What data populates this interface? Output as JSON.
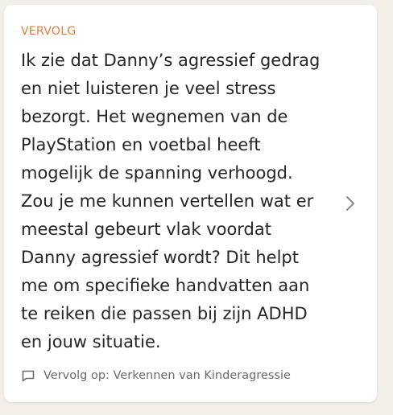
{
  "card": {
    "label": "VERVOLG",
    "body": "Ik zie dat Danny’s agressief gedrag en niet luisteren je veel stress bezorgt. Het wegnemen van de PlayStation en voetbal heeft mogelijk de spanning verhoogd. Zou je me kunnen vertellen wat er meestal gebeurt vlak voordat Danny agressief wordt? Dit helpt me om specifieke handvatten aan te reiken die passen bij zijn ADHD en jouw situatie.",
    "footer_text": "Vervolg op: Verkennen van Kinderagressie",
    "icons": {
      "footer": "speech-bubble-icon",
      "action": "chevron-right-icon"
    },
    "colors": {
      "label": "#e8793a",
      "body": "#262626",
      "footer": "#6b6b6b"
    }
  }
}
